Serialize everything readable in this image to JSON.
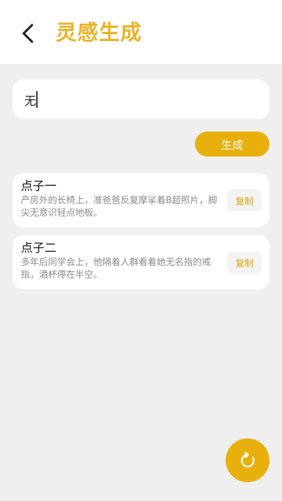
{
  "header": {
    "title": "灵感生成",
    "back_icon": "chevron-left-icon",
    "accent": "#e9b227"
  },
  "input": {
    "value": "无"
  },
  "generate": {
    "label": "生成",
    "color": "#e8b00d"
  },
  "ideas": [
    {
      "title": "点子一",
      "text": "产房外的长椅上，准爸爸反复摩挲着B超照片，脚尖无意识轻点地板。",
      "copy_label": "复制"
    },
    {
      "title": "点子二",
      "text": "多年后同学会上，他隔着人群看着她无名指的戒指，酒杯停在半空。",
      "copy_label": "复制"
    }
  ],
  "fab": {
    "icon": "refresh-icon",
    "color": "#e8b00d"
  }
}
